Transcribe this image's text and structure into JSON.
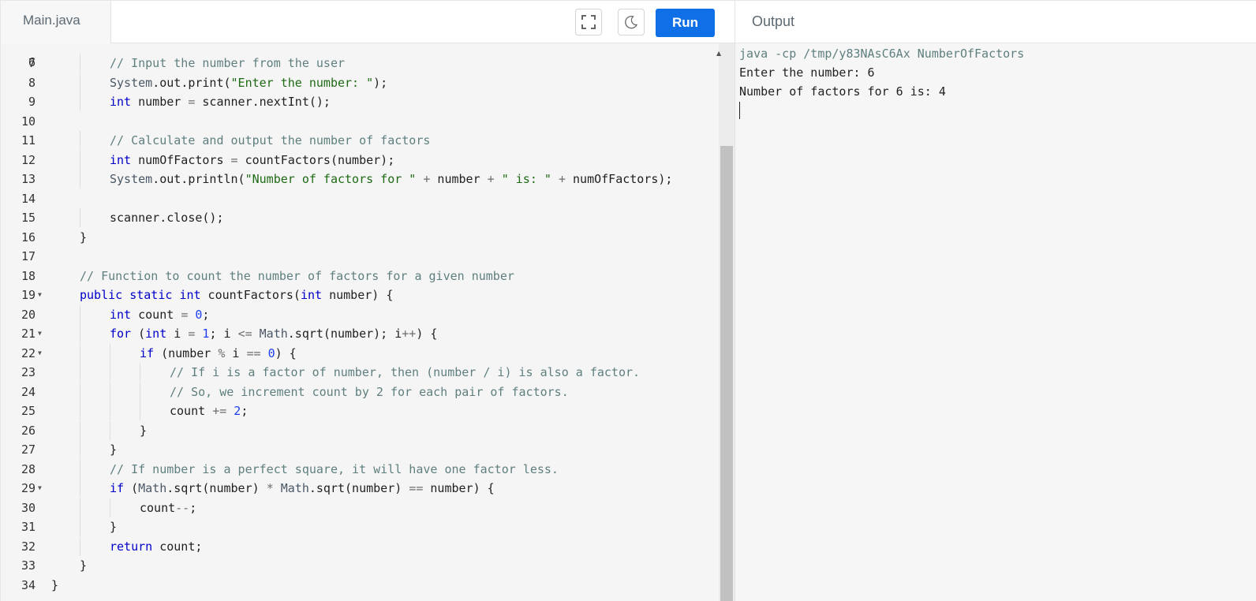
{
  "tabs": {
    "file": "Main.java",
    "run_label": "Run",
    "output_label": "Output"
  },
  "toolbar": {
    "fullscreen_icon": "fullscreen-icon",
    "theme_icon": "moon-icon"
  },
  "colors": {
    "run_button": "#0e6fe6",
    "keyword": "#0000c9",
    "comment": "#5f7f7f",
    "string": "#1e6a14",
    "number": "#1c3ef0"
  },
  "editor": {
    "partial_top_line": "6",
    "lines": [
      {
        "n": "7",
        "fold": false,
        "indent": 2,
        "t": [
          [
            "cm",
            "// Input the number from the user"
          ]
        ]
      },
      {
        "n": "8",
        "fold": false,
        "indent": 2,
        "t": [
          [
            "cls",
            "System"
          ],
          [
            "",
            "."
          ],
          [
            "",
            "out"
          ],
          [
            "",
            "."
          ],
          [
            "",
            "print("
          ],
          [
            "str",
            "\"Enter the number: \""
          ],
          [
            "",
            ");"
          ]
        ]
      },
      {
        "n": "9",
        "fold": false,
        "indent": 2,
        "t": [
          [
            "kw",
            "int"
          ],
          [
            "",
            " number "
          ],
          [
            "op",
            "="
          ],
          [
            "",
            " scanner.nextInt();"
          ]
        ]
      },
      {
        "n": "10",
        "fold": false,
        "indent": 0,
        "t": []
      },
      {
        "n": "11",
        "fold": false,
        "indent": 2,
        "t": [
          [
            "cm",
            "// Calculate and output the number of factors"
          ]
        ]
      },
      {
        "n": "12",
        "fold": false,
        "indent": 2,
        "t": [
          [
            "kw",
            "int"
          ],
          [
            "",
            " numOfFactors "
          ],
          [
            "op",
            "="
          ],
          [
            "",
            " countFactors(number);"
          ]
        ]
      },
      {
        "n": "13",
        "fold": false,
        "indent": 2,
        "t": [
          [
            "cls",
            "System"
          ],
          [
            "",
            ".out.println("
          ],
          [
            "str",
            "\"Number of factors for \""
          ],
          [
            "",
            " "
          ],
          [
            "op",
            "+"
          ],
          [
            "",
            " number "
          ],
          [
            "op",
            "+"
          ],
          [
            "",
            " "
          ],
          [
            "str",
            "\" is: \""
          ],
          [
            "",
            " "
          ],
          [
            "op",
            "+"
          ],
          [
            "",
            " numOfFactors);"
          ]
        ]
      },
      {
        "n": "14",
        "fold": false,
        "indent": 0,
        "t": []
      },
      {
        "n": "15",
        "fold": false,
        "indent": 2,
        "t": [
          [
            "",
            "scanner.close();"
          ]
        ]
      },
      {
        "n": "16",
        "fold": false,
        "indent": 1,
        "t": [
          [
            "",
            "}"
          ]
        ]
      },
      {
        "n": "17",
        "fold": false,
        "indent": 0,
        "t": []
      },
      {
        "n": "18",
        "fold": false,
        "indent": 1,
        "t": [
          [
            "cm",
            "// Function to count the number of factors for a given number"
          ]
        ]
      },
      {
        "n": "19",
        "fold": true,
        "indent": 1,
        "t": [
          [
            "kw",
            "public"
          ],
          [
            "",
            " "
          ],
          [
            "kw",
            "static"
          ],
          [
            "",
            " "
          ],
          [
            "kw",
            "int"
          ],
          [
            "",
            " countFactors("
          ],
          [
            "kw",
            "int"
          ],
          [
            "",
            " number) {"
          ]
        ]
      },
      {
        "n": "20",
        "fold": false,
        "indent": 2,
        "t": [
          [
            "kw",
            "int"
          ],
          [
            "",
            " count "
          ],
          [
            "op",
            "="
          ],
          [
            "",
            " "
          ],
          [
            "num",
            "0"
          ],
          [
            "",
            ";"
          ]
        ]
      },
      {
        "n": "21",
        "fold": true,
        "indent": 2,
        "t": [
          [
            "kw",
            "for"
          ],
          [
            "",
            " ("
          ],
          [
            "kw",
            "int"
          ],
          [
            "",
            " i "
          ],
          [
            "op",
            "="
          ],
          [
            "",
            " "
          ],
          [
            "num",
            "1"
          ],
          [
            "",
            "; i "
          ],
          [
            "op",
            "<="
          ],
          [
            "",
            " "
          ],
          [
            "cls",
            "Math"
          ],
          [
            "",
            ".sqrt(number); i"
          ],
          [
            "op",
            "++"
          ],
          [
            "",
            ") {"
          ]
        ]
      },
      {
        "n": "22",
        "fold": true,
        "indent": 3,
        "t": [
          [
            "kw",
            "if"
          ],
          [
            "",
            " (number "
          ],
          [
            "op",
            "%"
          ],
          [
            "",
            " i "
          ],
          [
            "op",
            "=="
          ],
          [
            "",
            " "
          ],
          [
            "num",
            "0"
          ],
          [
            "",
            ") {"
          ]
        ]
      },
      {
        "n": "23",
        "fold": false,
        "indent": 4,
        "t": [
          [
            "cm",
            "// If i is a factor of number, then (number / i) is also a factor."
          ]
        ]
      },
      {
        "n": "24",
        "fold": false,
        "indent": 4,
        "t": [
          [
            "cm",
            "// So, we increment count by 2 for each pair of factors."
          ]
        ]
      },
      {
        "n": "25",
        "fold": false,
        "indent": 4,
        "t": [
          [
            "",
            "count "
          ],
          [
            "op",
            "+="
          ],
          [
            "",
            " "
          ],
          [
            "num",
            "2"
          ],
          [
            "",
            ";"
          ]
        ]
      },
      {
        "n": "26",
        "fold": false,
        "indent": 3,
        "t": [
          [
            "",
            "}"
          ]
        ]
      },
      {
        "n": "27",
        "fold": false,
        "indent": 2,
        "t": [
          [
            "",
            "}"
          ]
        ]
      },
      {
        "n": "28",
        "fold": false,
        "indent": 2,
        "t": [
          [
            "cm",
            "// If number is a perfect square, it will have one factor less."
          ]
        ]
      },
      {
        "n": "29",
        "fold": true,
        "indent": 2,
        "t": [
          [
            "kw",
            "if"
          ],
          [
            "",
            " ("
          ],
          [
            "cls",
            "Math"
          ],
          [
            "",
            ".sqrt(number) "
          ],
          [
            "op",
            "*"
          ],
          [
            "",
            " "
          ],
          [
            "cls",
            "Math"
          ],
          [
            "",
            ".sqrt(number) "
          ],
          [
            "op",
            "=="
          ],
          [
            "",
            " number) {"
          ]
        ]
      },
      {
        "n": "30",
        "fold": false,
        "indent": 3,
        "t": [
          [
            "",
            "count"
          ],
          [
            "op",
            "--"
          ],
          [
            "",
            ";"
          ]
        ]
      },
      {
        "n": "31",
        "fold": false,
        "indent": 2,
        "t": [
          [
            "",
            "}"
          ]
        ]
      },
      {
        "n": "32",
        "fold": false,
        "indent": 2,
        "t": [
          [
            "kw",
            "return"
          ],
          [
            "",
            " count;"
          ]
        ]
      },
      {
        "n": "33",
        "fold": false,
        "indent": 1,
        "t": [
          [
            "",
            "}"
          ]
        ]
      },
      {
        "n": "34",
        "fold": false,
        "indent": 0,
        "t": [
          [
            "",
            "}"
          ]
        ]
      }
    ]
  },
  "output": {
    "command": "java -cp /tmp/y83NAsC6Ax NumberOfFactors",
    "lines": [
      "Enter the number: 6",
      "Number of factors for 6 is: 4"
    ]
  }
}
